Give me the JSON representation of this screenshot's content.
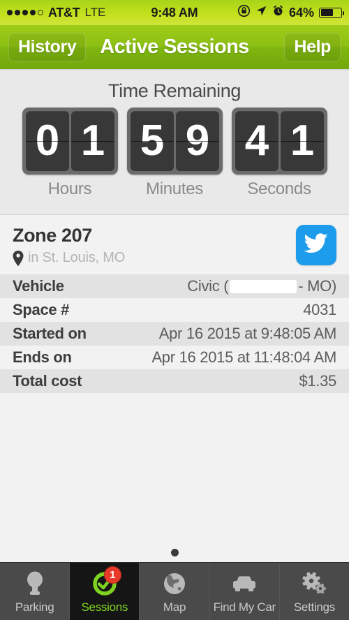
{
  "status_bar": {
    "signal_dots_filled": 4,
    "signal_dots_total": 5,
    "carrier": "AT&T",
    "network": "LTE",
    "time": "9:48 AM",
    "battery_percent": "64%",
    "battery_level": 64,
    "icons": [
      "rotation-lock-icon",
      "location-arrow-icon",
      "alarm-clock-icon"
    ]
  },
  "navbar": {
    "left_button": "History",
    "title": "Active Sessions",
    "right_button": "Help"
  },
  "timer": {
    "title": "Time Remaining",
    "hours": "01",
    "minutes": "59",
    "seconds": "41",
    "hours_label": "Hours",
    "minutes_label": "Minutes",
    "seconds_label": "Seconds",
    "hours_digits": [
      "0",
      "1"
    ],
    "minutes_digits": [
      "5",
      "9"
    ],
    "seconds_digits": [
      "4",
      "1"
    ]
  },
  "session": {
    "zone": "Zone 207",
    "location": "in St. Louis, MO",
    "share_icon": "twitter-icon",
    "details": [
      {
        "label": "Vehicle",
        "value": "Civic (",
        "redacted": true,
        "value_suffix": " - MO)"
      },
      {
        "label": "Space #",
        "value": "4031"
      },
      {
        "label": "Started on",
        "value": "Apr 16 2015 at 9:48:05 AM"
      },
      {
        "label": "Ends on",
        "value": "Apr 16 2015 at 11:48:04 AM"
      },
      {
        "label": "Total cost",
        "value": "$1.35"
      }
    ]
  },
  "page_indicator": {
    "pages": 1,
    "current": 0
  },
  "tabbar": {
    "items": [
      {
        "label": "Parking",
        "icon": "parking-meter-icon",
        "active": false,
        "badge": null
      },
      {
        "label": "Sessions",
        "icon": "check-circle-icon",
        "active": true,
        "badge": "1"
      },
      {
        "label": "Map",
        "icon": "globe-icon",
        "active": false,
        "badge": null
      },
      {
        "label": "Find My Car",
        "icon": "car-icon",
        "active": false,
        "badge": null
      },
      {
        "label": "Settings",
        "icon": "gears-icon",
        "active": false,
        "badge": null
      }
    ]
  },
  "colors": {
    "status_green": "#c4e01c",
    "nav_green": "#8cc014",
    "accent_green": "#7ed321",
    "twitter_blue": "#1c9cea",
    "badge_red": "#e8392b"
  }
}
